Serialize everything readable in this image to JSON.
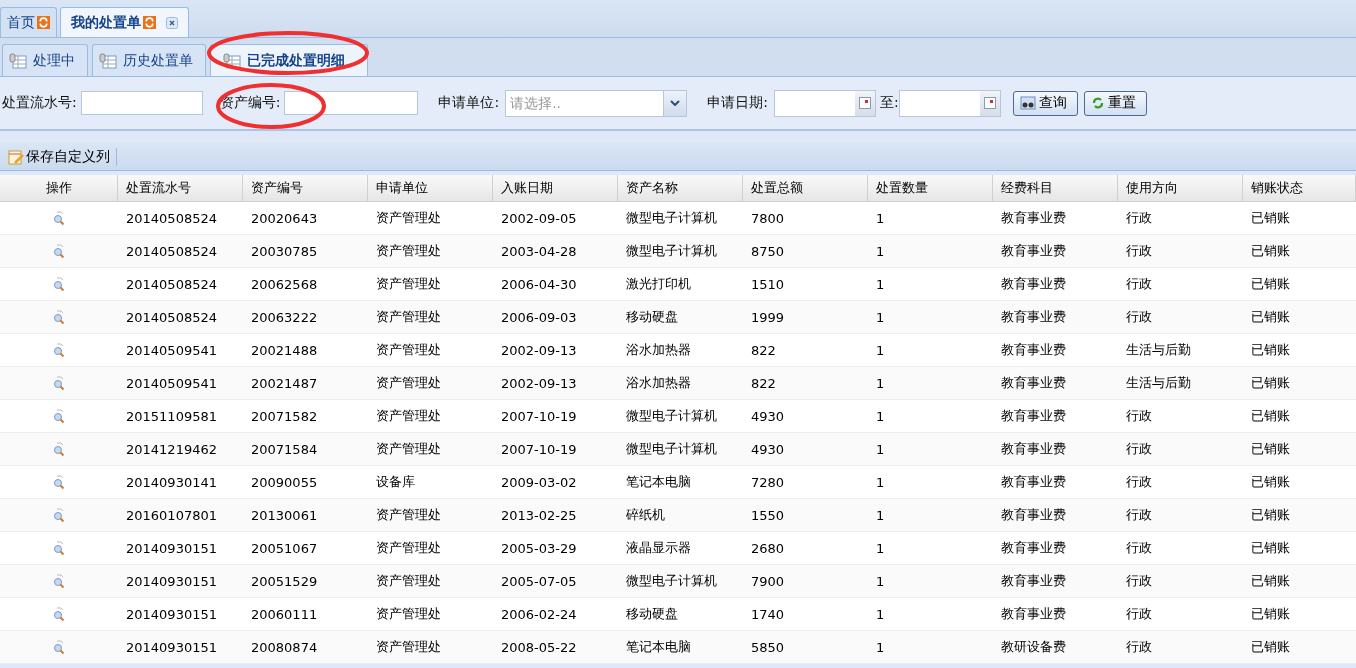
{
  "top_tabs": [
    {
      "label": "首页",
      "selected": false,
      "closable": false
    },
    {
      "label": "我的处置单",
      "selected": true,
      "closable": true
    }
  ],
  "sub_tabs": [
    {
      "label": "处理中",
      "selected": false
    },
    {
      "label": "历史处置单",
      "selected": false
    },
    {
      "label": "已完成处置明细",
      "selected": true
    }
  ],
  "filters": {
    "serial_label": "处置流水号:",
    "asset_label": "资产编号:",
    "unit_label": "申请单位:",
    "unit_placeholder": "请选择..",
    "date_label": "申请日期:",
    "to_label": "至:",
    "query_button": "查询",
    "reset_button": "重置"
  },
  "toolbar": {
    "save_columns": "保存自定义列"
  },
  "table": {
    "action_column": "操作",
    "columns": [
      "处置流水号",
      "资产编号",
      "申请单位",
      "入账日期",
      "资产名称",
      "处置总额",
      "处置数量",
      "经费科目",
      "使用方向",
      "销账状态"
    ],
    "rows": [
      [
        "20140508524",
        "20020643",
        "资产管理处",
        "2002-09-05",
        "微型电子计算机",
        "7800",
        "1",
        "教育事业费",
        "行政",
        "已销账"
      ],
      [
        "20140508524",
        "20030785",
        "资产管理处",
        "2003-04-28",
        "微型电子计算机",
        "8750",
        "1",
        "教育事业费",
        "行政",
        "已销账"
      ],
      [
        "20140508524",
        "20062568",
        "资产管理处",
        "2006-04-30",
        "激光打印机",
        "1510",
        "1",
        "教育事业费",
        "行政",
        "已销账"
      ],
      [
        "20140508524",
        "20063222",
        "资产管理处",
        "2006-09-03",
        "移动硬盘",
        "1999",
        "1",
        "教育事业费",
        "行政",
        "已销账"
      ],
      [
        "20140509541",
        "20021488",
        "资产管理处",
        "2002-09-13",
        "浴水加热器",
        "822",
        "1",
        "教育事业费",
        "生活与后勤",
        "已销账"
      ],
      [
        "20140509541",
        "20021487",
        "资产管理处",
        "2002-09-13",
        "浴水加热器",
        "822",
        "1",
        "教育事业费",
        "生活与后勤",
        "已销账"
      ],
      [
        "20151109581",
        "20071582",
        "资产管理处",
        "2007-10-19",
        "微型电子计算机",
        "4930",
        "1",
        "教育事业费",
        "行政",
        "已销账"
      ],
      [
        "20141219462",
        "20071584",
        "资产管理处",
        "2007-10-19",
        "微型电子计算机",
        "4930",
        "1",
        "教育事业费",
        "行政",
        "已销账"
      ],
      [
        "20140930141",
        "20090055",
        "设备库",
        "2009-03-02",
        "笔记本电脑",
        "7280",
        "1",
        "教育事业费",
        "行政",
        "已销账"
      ],
      [
        "20160107801",
        "20130061",
        "资产管理处",
        "2013-02-25",
        "碎纸机",
        "1550",
        "1",
        "教育事业费",
        "行政",
        "已销账"
      ],
      [
        "20140930151",
        "20051067",
        "资产管理处",
        "2005-03-29",
        "液晶显示器",
        "2680",
        "1",
        "教育事业费",
        "行政",
        "已销账"
      ],
      [
        "20140930151",
        "20051529",
        "资产管理处",
        "2005-07-05",
        "微型电子计算机",
        "7900",
        "1",
        "教育事业费",
        "行政",
        "已销账"
      ],
      [
        "20140930151",
        "20060111",
        "资产管理处",
        "2006-02-24",
        "移动硬盘",
        "1740",
        "1",
        "教育事业费",
        "行政",
        "已销账"
      ],
      [
        "20140930151",
        "20080874",
        "资产管理处",
        "2008-05-22",
        "笔记本电脑",
        "5850",
        "1",
        "教研设备费",
        "行政",
        "已销账"
      ]
    ]
  }
}
